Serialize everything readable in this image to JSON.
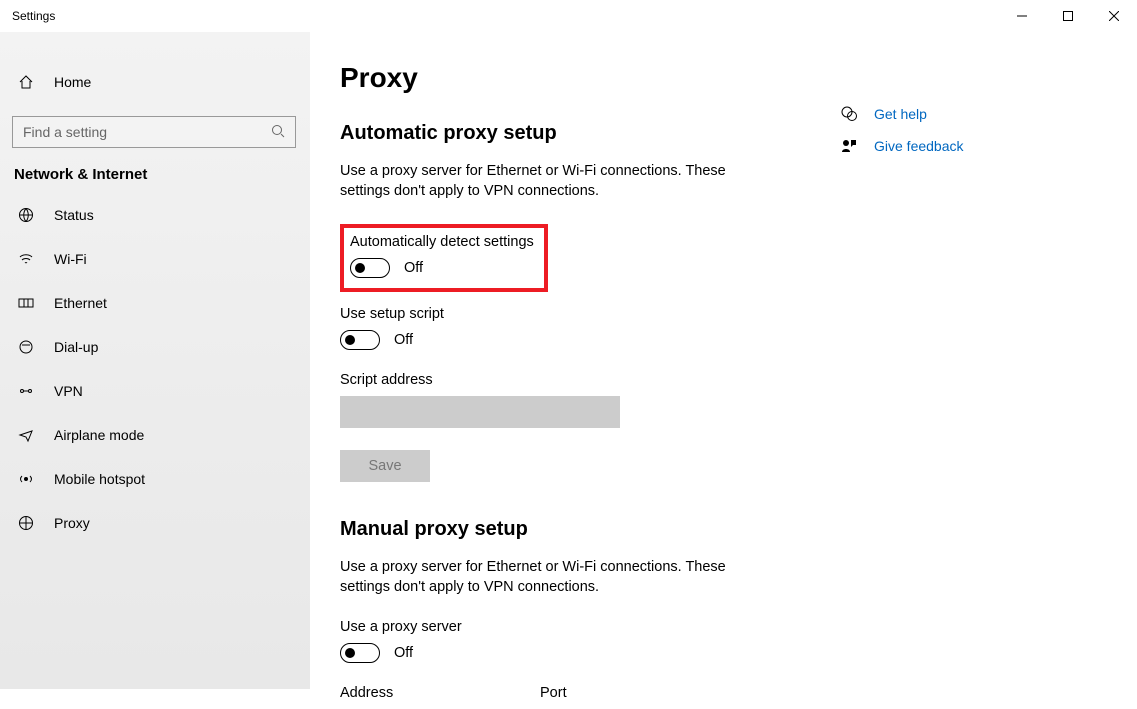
{
  "titlebar": {
    "title": "Settings"
  },
  "sidebar": {
    "home": "Home",
    "search_placeholder": "Find a setting",
    "category": "Network & Internet",
    "items": [
      {
        "label": "Status"
      },
      {
        "label": "Wi-Fi"
      },
      {
        "label": "Ethernet"
      },
      {
        "label": "Dial-up"
      },
      {
        "label": "VPN"
      },
      {
        "label": "Airplane mode"
      },
      {
        "label": "Mobile hotspot"
      },
      {
        "label": "Proxy"
      }
    ]
  },
  "main": {
    "title": "Proxy",
    "auto": {
      "heading": "Automatic proxy setup",
      "desc": "Use a proxy server for Ethernet or Wi-Fi connections. These settings don't apply to VPN connections.",
      "detect_label": "Automatically detect settings",
      "detect_state": "Off",
      "script_label": "Use setup script",
      "script_state": "Off",
      "addr_label": "Script address",
      "save": "Save"
    },
    "manual": {
      "heading": "Manual proxy setup",
      "desc": "Use a proxy server for Ethernet or Wi-Fi connections. These settings don't apply to VPN connections.",
      "use_label": "Use a proxy server",
      "use_state": "Off",
      "addr_label": "Address",
      "port_label": "Port"
    }
  },
  "help": {
    "get_help": "Get help",
    "feedback": "Give feedback"
  }
}
